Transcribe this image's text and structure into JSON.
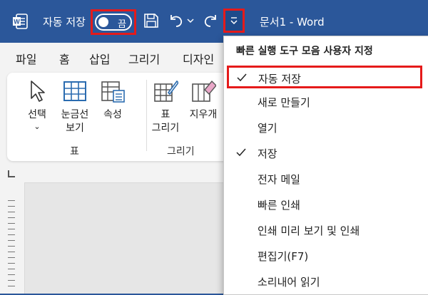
{
  "titlebar": {
    "autosave_label": "자동 저장",
    "autosave_state": "끔",
    "doc_title": "문서1  -  Word"
  },
  "tabs": [
    "파일",
    "홈",
    "삽입",
    "그리기",
    "디자인"
  ],
  "ribbon": {
    "buttons": {
      "select": "선택",
      "gridlines_line1": "눈금선",
      "gridlines_line2": "보기",
      "properties": "속성",
      "draw_table_line1": "표",
      "draw_table_line2": "그리기",
      "eraser": "지우개"
    },
    "groups": {
      "table": "표",
      "draw": "그리기"
    }
  },
  "qat_menu": {
    "header": "빠른 실행 도구 모음 사용자 지정",
    "items": [
      {
        "label": "자동 저장",
        "checked": true,
        "highlighted": true
      },
      {
        "label": "새로 만들기",
        "checked": false
      },
      {
        "label": "열기",
        "checked": false
      },
      {
        "label": "저장",
        "checked": true
      },
      {
        "label": "전자 메일",
        "checked": false
      },
      {
        "label": "빠른 인쇄",
        "checked": false
      },
      {
        "label": "인쇄 미리 보기 및 인쇄",
        "checked": false
      },
      {
        "label": "편집기(F7)",
        "checked": false
      },
      {
        "label": "소리내어 읽기",
        "checked": false
      }
    ]
  },
  "colors": {
    "title_bar": "#2b579a",
    "highlight_border": "#e51a1a"
  }
}
